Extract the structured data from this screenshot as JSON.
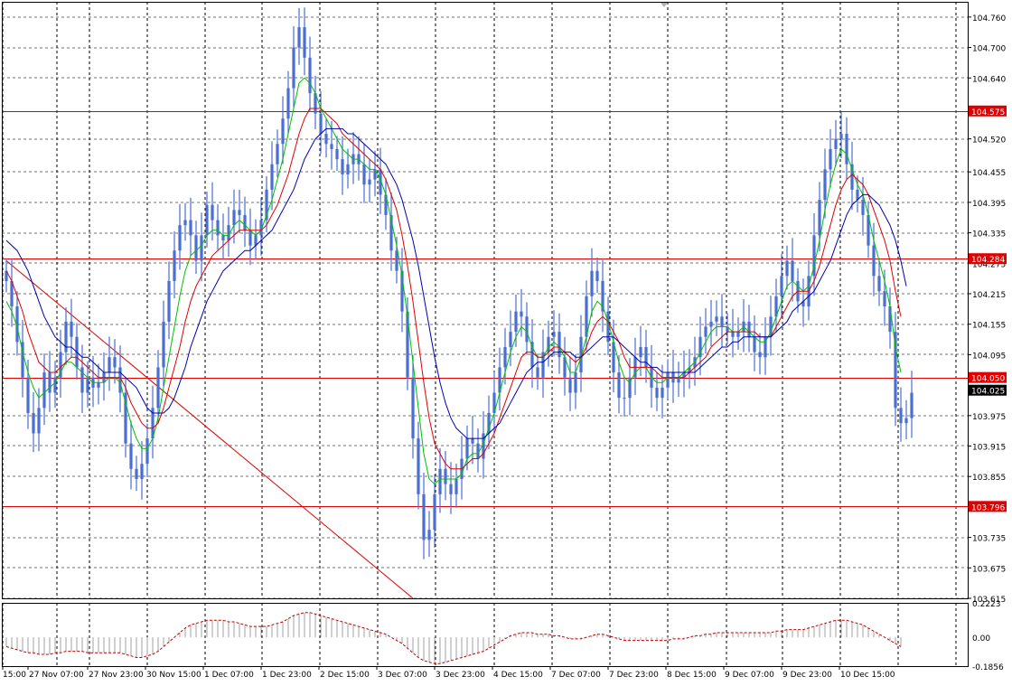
{
  "colors": {
    "background": "#ffffff",
    "grid": "#000000",
    "candles": "#4a6fd4",
    "level_lines": "#e00000",
    "trendline": "#e00000",
    "ma_fast": "#00c000",
    "ma_mid": "#e00000",
    "ma_slow": "#0000b0",
    "price_label_bg": "#e00000",
    "current_label_bg": "#000000",
    "oscillator": "#c00000",
    "oscillator_hist": "#a0a0a0"
  },
  "chart_data": [
    {
      "type": "candlestick",
      "title": "",
      "xlabel": "",
      "ylabel": "",
      "ylim": [
        103.615,
        104.79
      ],
      "grid": true,
      "x_tick_labels": [
        "15:00",
        "27 Nov 07:00",
        "27 Nov 23:00",
        "30 Nov 15:00",
        "1 Dec 07:00",
        "1 Dec 23:00",
        "2 Dec 15:00",
        "3 Dec 07:00",
        "3 Dec 23:00",
        "4 Dec 15:00",
        "7 Dec 07:00",
        "7 Dec 23:00",
        "8 Dec 15:00",
        "9 Dec 07:00",
        "9 Dec 23:00",
        "10 Dec 15:00"
      ],
      "y_tick_labels": [
        "104.760",
        "104.700",
        "104.640",
        "104.520",
        "104.455",
        "104.395",
        "104.335",
        "104.275",
        "104.215",
        "104.155",
        "104.095",
        "103.975",
        "103.915",
        "103.855",
        "103.735",
        "103.675",
        "103.615"
      ],
      "y_ticks": [
        104.76,
        104.7,
        104.64,
        104.52,
        104.455,
        104.395,
        104.335,
        104.275,
        104.215,
        104.155,
        104.095,
        103.975,
        103.915,
        103.855,
        103.735,
        103.675,
        103.615
      ],
      "horizontal_levels": [
        {
          "label": "104.575",
          "value": 104.575
        },
        {
          "label": "104.284",
          "value": 104.284
        },
        {
          "label": "104.050",
          "value": 104.05
        },
        {
          "label": "103.796",
          "value": 103.796
        }
      ],
      "current_price": {
        "label": "104.025",
        "value": 104.025
      },
      "trendline": {
        "from": {
          "bar": 0,
          "price": 104.28
        },
        "to": {
          "bar": 75,
          "price": 103.615
        }
      },
      "closes": [
        104.24,
        104.19,
        104.12,
        104.05,
        103.98,
        103.94,
        103.99,
        104.06,
        104.02,
        104.05,
        104.1,
        104.16,
        104.13,
        104.07,
        104.02,
        104.05,
        104.03,
        104.04,
        104.06,
        104.09,
        104.07,
        104.02,
        103.92,
        103.87,
        103.85,
        103.88,
        103.93,
        103.99,
        104.07,
        104.16,
        104.24,
        104.3,
        104.35,
        104.36,
        104.33,
        104.28,
        104.33,
        104.39,
        104.36,
        104.33,
        104.32,
        104.35,
        104.38,
        104.37,
        104.34,
        104.31,
        104.33,
        104.36,
        104.42,
        104.47,
        104.51,
        104.56,
        104.62,
        104.7,
        104.74,
        104.68,
        104.61,
        104.57,
        104.53,
        104.51,
        104.5,
        104.48,
        104.45,
        104.47,
        104.49,
        104.47,
        104.43,
        104.44,
        104.46,
        104.41,
        104.37,
        104.3,
        104.26,
        104.18,
        104.05,
        103.93,
        103.82,
        103.73,
        103.75,
        103.82,
        103.87,
        103.84,
        103.82,
        103.85,
        103.89,
        103.93,
        103.92,
        103.89,
        103.94,
        103.98,
        104.02,
        104.07,
        104.11,
        104.14,
        104.18,
        104.17,
        104.12,
        104.07,
        104.05,
        104.1,
        104.13,
        104.14,
        104.09,
        104.05,
        104.02,
        104.06,
        104.13,
        104.21,
        104.26,
        104.24,
        104.18,
        104.12,
        104.06,
        104.01,
        104.01,
        104.05,
        104.09,
        104.11,
        104.07,
        104.03,
        104.01,
        104.03,
        104.06,
        104.04,
        104.05,
        104.06,
        104.07,
        104.09,
        104.13,
        104.15,
        104.16,
        104.17,
        104.15,
        104.14,
        104.13,
        104.14,
        104.16,
        104.13,
        104.1,
        104.09,
        104.13,
        104.17,
        104.21,
        104.25,
        104.28,
        104.24,
        104.2,
        104.19,
        104.25,
        104.33,
        104.4,
        104.46,
        104.5,
        104.52,
        104.53,
        104.47,
        104.42,
        104.4,
        104.37,
        104.31,
        104.25,
        104.22,
        104.19,
        104.14,
        103.99,
        103.96,
        103.97,
        104.02
      ],
      "ma_fast_start": 0,
      "ma_fast": [
        104.2,
        104.18,
        104.15,
        104.1,
        104.06,
        104.03,
        104.01,
        104.02,
        104.03,
        104.04,
        104.06,
        104.08,
        104.08,
        104.07,
        104.06,
        104.05,
        104.04,
        104.04,
        104.04,
        104.05,
        104.05,
        104.04,
        104.0,
        103.96,
        103.93,
        103.91,
        103.91,
        103.93,
        103.97,
        104.03,
        104.09,
        104.15,
        104.21,
        104.26,
        104.29,
        104.3,
        104.31,
        104.33,
        104.34,
        104.34,
        104.33,
        104.33,
        104.35,
        104.36,
        104.35,
        104.34,
        104.33,
        104.34,
        104.37,
        104.4,
        104.44,
        104.48,
        104.53,
        104.58,
        104.63,
        104.64,
        104.63,
        104.61,
        104.58,
        104.56,
        104.54,
        104.52,
        104.5,
        104.49,
        104.48,
        104.48,
        104.47,
        104.46,
        104.46,
        104.44,
        104.41,
        104.36,
        104.31,
        104.25,
        104.17,
        104.08,
        103.99,
        103.9,
        103.85,
        103.84,
        103.85,
        103.85,
        103.85,
        103.85,
        103.86,
        103.89,
        103.9,
        103.9,
        103.92,
        103.95,
        103.98,
        104.02,
        104.06,
        104.1,
        104.13,
        104.15,
        104.14,
        104.11,
        104.09,
        104.09,
        104.11,
        104.12,
        104.11,
        104.09,
        104.06,
        104.06,
        104.09,
        104.13,
        104.18,
        104.2,
        104.19,
        104.16,
        104.12,
        104.08,
        104.05,
        104.04,
        104.06,
        104.07,
        104.07,
        104.05,
        104.04,
        104.04,
        104.05,
        104.05,
        104.05,
        104.06,
        104.07,
        104.08,
        104.1,
        104.12,
        104.14,
        104.15,
        104.15,
        104.15,
        104.14,
        104.14,
        104.15,
        104.14,
        104.13,
        104.12,
        104.12,
        104.14,
        104.17,
        104.2,
        104.23,
        104.24,
        104.23,
        104.22,
        104.23,
        104.27,
        104.32,
        104.38,
        104.43,
        104.47,
        104.5,
        104.49,
        104.46,
        104.43,
        104.41,
        104.37,
        104.32,
        104.28,
        104.24,
        104.19,
        104.11,
        104.06
      ],
      "ma_mid_start": 0,
      "ma_mid": [
        104.26,
        104.24,
        104.21,
        104.18,
        104.14,
        104.11,
        104.08,
        104.07,
        104.06,
        104.06,
        104.07,
        104.08,
        104.09,
        104.09,
        104.08,
        104.07,
        104.06,
        104.05,
        104.05,
        104.05,
        104.05,
        104.05,
        104.03,
        104.0,
        103.98,
        103.96,
        103.95,
        103.95,
        103.96,
        103.99,
        104.03,
        104.07,
        104.11,
        104.16,
        104.2,
        104.23,
        104.25,
        104.27,
        104.29,
        104.3,
        104.31,
        104.32,
        104.33,
        104.34,
        104.34,
        104.34,
        104.34,
        104.34,
        104.35,
        104.37,
        104.39,
        104.42,
        104.45,
        104.49,
        104.53,
        104.56,
        104.58,
        104.58,
        104.58,
        104.57,
        104.56,
        104.55,
        104.53,
        104.52,
        104.51,
        104.5,
        104.49,
        104.48,
        104.47,
        104.46,
        104.44,
        104.41,
        104.38,
        104.33,
        104.27,
        104.2,
        104.12,
        104.04,
        103.97,
        103.92,
        103.9,
        103.88,
        103.87,
        103.87,
        103.87,
        103.88,
        103.89,
        103.89,
        103.9,
        103.92,
        103.94,
        103.97,
        104.0,
        104.03,
        104.06,
        104.09,
        104.1,
        104.1,
        104.09,
        104.09,
        104.1,
        104.11,
        104.11,
        104.1,
        104.09,
        104.08,
        104.09,
        104.11,
        104.14,
        104.16,
        104.17,
        104.16,
        104.14,
        104.12,
        104.09,
        104.07,
        104.07,
        104.07,
        104.07,
        104.07,
        104.06,
        104.05,
        104.05,
        104.05,
        104.05,
        104.05,
        104.06,
        104.07,
        104.08,
        104.09,
        104.11,
        104.12,
        104.13,
        104.14,
        104.14,
        104.14,
        104.14,
        104.14,
        104.14,
        104.13,
        104.13,
        104.13,
        104.15,
        104.17,
        104.19,
        104.21,
        104.22,
        104.22,
        104.22,
        104.24,
        104.27,
        104.31,
        104.35,
        104.39,
        104.42,
        104.44,
        104.45,
        104.44,
        104.43,
        104.41,
        104.38,
        104.35,
        104.32,
        104.28,
        104.22,
        104.17
      ],
      "ma_slow_start": 0,
      "ma_slow": [
        104.32,
        104.31,
        104.3,
        104.28,
        104.26,
        104.23,
        104.2,
        104.17,
        104.15,
        104.13,
        104.12,
        104.11,
        104.11,
        104.1,
        104.09,
        104.09,
        104.08,
        104.07,
        104.06,
        104.06,
        104.06,
        104.06,
        104.05,
        104.04,
        104.03,
        104.01,
        103.99,
        103.98,
        103.98,
        103.98,
        103.99,
        104.01,
        104.04,
        104.07,
        104.11,
        104.14,
        104.17,
        104.2,
        104.22,
        104.24,
        104.26,
        104.27,
        104.28,
        104.29,
        104.3,
        104.3,
        104.31,
        104.32,
        104.33,
        104.34,
        104.36,
        104.38,
        104.4,
        104.42,
        104.45,
        104.48,
        104.5,
        104.52,
        104.53,
        104.54,
        104.54,
        104.54,
        104.54,
        104.53,
        104.53,
        104.52,
        104.51,
        104.5,
        104.49,
        104.48,
        104.47,
        104.45,
        104.43,
        104.4,
        104.36,
        104.32,
        104.27,
        104.21,
        104.15,
        104.09,
        104.04,
        104.0,
        103.97,
        103.95,
        103.94,
        103.93,
        103.93,
        103.93,
        103.93,
        103.94,
        103.95,
        103.96,
        103.98,
        104.0,
        104.02,
        104.04,
        104.06,
        104.07,
        104.08,
        104.08,
        104.09,
        104.1,
        104.1,
        104.1,
        104.1,
        104.09,
        104.09,
        104.1,
        104.11,
        104.12,
        104.13,
        104.13,
        104.13,
        104.12,
        104.11,
        104.1,
        104.09,
        104.08,
        104.08,
        104.07,
        104.07,
        104.06,
        104.06,
        104.06,
        104.06,
        104.06,
        104.06,
        104.06,
        104.07,
        104.08,
        104.09,
        104.1,
        104.11,
        104.11,
        104.12,
        104.12,
        104.13,
        104.13,
        104.13,
        104.13,
        104.13,
        104.13,
        104.14,
        104.15,
        104.16,
        104.18,
        104.19,
        104.2,
        104.21,
        104.22,
        104.24,
        104.26,
        104.28,
        104.31,
        104.34,
        104.37,
        104.39,
        104.4,
        104.41,
        104.41,
        104.4,
        104.39,
        104.37,
        104.35,
        104.32,
        104.28,
        104.23
      ]
    },
    {
      "type": "area",
      "title": "",
      "xlabel": "",
      "ylabel": "",
      "ylim": [
        -0.1856,
        0.2223
      ],
      "y_tick_labels": [
        "0.2223",
        "0.00",
        "-0.1856"
      ],
      "y_ticks": [
        0.2223,
        0.0,
        -0.1856
      ],
      "values": [
        -0.06,
        -0.07,
        -0.08,
        -0.09,
        -0.1,
        -0.1,
        -0.11,
        -0.11,
        -0.11,
        -0.1,
        -0.1,
        -0.09,
        -0.09,
        -0.09,
        -0.09,
        -0.1,
        -0.1,
        -0.1,
        -0.1,
        -0.1,
        -0.1,
        -0.1,
        -0.11,
        -0.12,
        -0.13,
        -0.13,
        -0.12,
        -0.11,
        -0.09,
        -0.06,
        -0.03,
        0.0,
        0.03,
        0.06,
        0.08,
        0.09,
        0.1,
        0.11,
        0.11,
        0.11,
        0.11,
        0.1,
        0.1,
        0.09,
        0.08,
        0.07,
        0.07,
        0.07,
        0.07,
        0.08,
        0.09,
        0.1,
        0.12,
        0.14,
        0.15,
        0.16,
        0.16,
        0.15,
        0.14,
        0.13,
        0.12,
        0.11,
        0.1,
        0.09,
        0.08,
        0.07,
        0.06,
        0.05,
        0.04,
        0.03,
        0.02,
        0.0,
        -0.02,
        -0.04,
        -0.07,
        -0.1,
        -0.13,
        -0.15,
        -0.16,
        -0.17,
        -0.17,
        -0.16,
        -0.15,
        -0.14,
        -0.13,
        -0.12,
        -0.11,
        -0.1,
        -0.09,
        -0.07,
        -0.05,
        -0.03,
        -0.01,
        0.01,
        0.02,
        0.03,
        0.03,
        0.03,
        0.02,
        0.02,
        0.02,
        0.01,
        0.01,
        0.0,
        -0.01,
        -0.01,
        -0.01,
        0.0,
        0.01,
        0.02,
        0.02,
        0.01,
        0.0,
        -0.01,
        -0.02,
        -0.02,
        -0.02,
        -0.02,
        -0.02,
        -0.02,
        -0.02,
        -0.02,
        -0.02,
        -0.01,
        -0.01,
        -0.01,
        0.0,
        0.01,
        0.01,
        0.02,
        0.02,
        0.03,
        0.03,
        0.03,
        0.03,
        0.03,
        0.03,
        0.03,
        0.03,
        0.03,
        0.03,
        0.03,
        0.04,
        0.04,
        0.05,
        0.05,
        0.05,
        0.05,
        0.06,
        0.07,
        0.08,
        0.09,
        0.1,
        0.11,
        0.11,
        0.11,
        0.1,
        0.09,
        0.08,
        0.06,
        0.04,
        0.02,
        0.0,
        -0.02,
        -0.04,
        -0.06
      ]
    }
  ]
}
